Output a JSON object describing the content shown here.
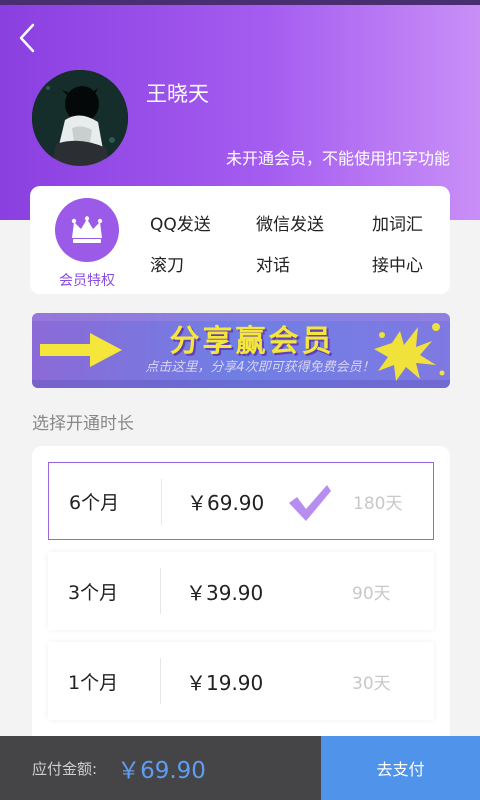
{
  "header": {
    "username": "王晓天",
    "vip_status": "未开通会员，不能使用扣字功能"
  },
  "privileges": {
    "label": "会员特权",
    "features": [
      "QQ发送",
      "微信发送",
      "加词汇",
      "滚刀",
      "对话",
      "接中心"
    ]
  },
  "banner": {
    "title": "分享赢会员",
    "subtitle": "点击这里，分享4次即可获得免费会员！"
  },
  "duration": {
    "label": "选择开通时长",
    "plans": [
      {
        "months": "6个月",
        "price": "￥69.90",
        "days": "180天",
        "selected": true
      },
      {
        "months": "3个月",
        "price": "￥39.90",
        "days": "90天",
        "selected": false
      },
      {
        "months": "1个月",
        "price": "￥19.90",
        "days": "30天",
        "selected": false
      }
    ]
  },
  "footer": {
    "total_label": "应付金额:",
    "total_amount": "￥69.90",
    "pay_button": "去支付"
  },
  "colors": {
    "brand_purple": "#9b5ae7",
    "pay_blue": "#4f94ea",
    "banner_yellow": "#f5e63b"
  },
  "icons": {
    "back": "chevron-left-icon",
    "crown": "crown-icon",
    "check": "checkmark-icon",
    "arrow": "arrow-right-icon"
  }
}
